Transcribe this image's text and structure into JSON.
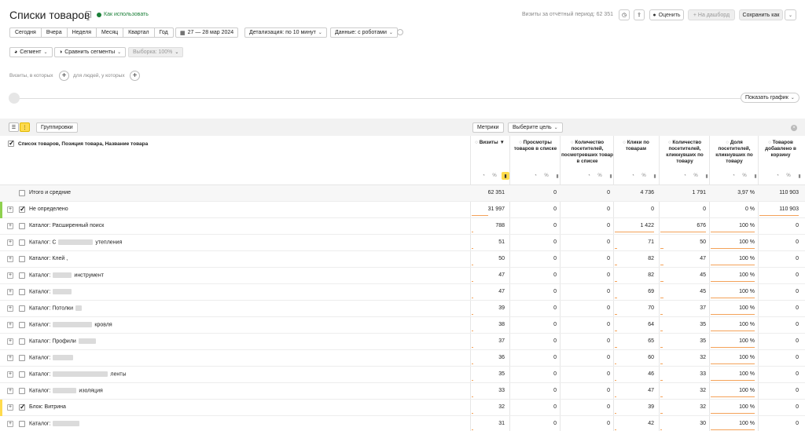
{
  "header": {
    "title": "Списки товаров",
    "howto": "Как использовать",
    "visits_period": "Визиты за отчётный период: 62 351",
    "rate": "Оценить",
    "dashboard": "+ На дашборд",
    "save_as": "Сохранить как"
  },
  "period": {
    "buttons": [
      "Сегодня",
      "Вчера",
      "Неделя",
      "Месяц",
      "Квартал",
      "Год"
    ],
    "date_range": "27 — 28 мар 2024",
    "detail": "Детализация: по 10 минут",
    "data": "Данные: с роботами"
  },
  "segments": {
    "segment": "Сегмент",
    "compare": "Сравнить сегменты",
    "sample": "Выборка: 100%"
  },
  "filters": {
    "visits_hint": "Визиты, в которых",
    "people_hint": "для людей, у которых"
  },
  "graph": {
    "show": "Показать график"
  },
  "table_toolbar": {
    "groupings": "Группировки",
    "metrics": "Метрики",
    "goal": "Выберите цель"
  },
  "dimension_header": "Список товаров, Позиция товара, Название товара",
  "columns": [
    {
      "label": "Визиты",
      "sort": "▼"
    },
    {
      "label": "Просмотры товаров в списке"
    },
    {
      "label": "Количество посетителей, посмотревших товар в списке"
    },
    {
      "label": "Клики по товарам"
    },
    {
      "label": "Количество посетителей, кликнувших по товару"
    },
    {
      "label": "Доля посетителей, кликнувших по товару"
    },
    {
      "label": "Товаров добавлено в корзину"
    }
  ],
  "totals": {
    "label": "Итого и средние",
    "values": [
      "62 351",
      "0",
      "0",
      "4 736",
      "1 791",
      "3,97 %",
      "110 903"
    ]
  },
  "rows": [
    {
      "label": "Не определено",
      "checked": true,
      "marker": "#8fd14f",
      "values": [
        "31 997",
        "0",
        "0",
        "0",
        "0",
        "0 %",
        "110 903"
      ],
      "fill": [
        0.51,
        0,
        0,
        0,
        0,
        0,
        1
      ]
    },
    {
      "label": "Каталог: Расширенный поиск",
      "values": [
        "788",
        "0",
        "0",
        "1 422",
        "676",
        "100 %",
        "0"
      ],
      "fill": [
        0.02,
        0,
        0,
        1,
        1,
        1,
        0
      ]
    },
    {
      "label": "Каталог: С",
      "suffix": "утепления",
      "blur": 44,
      "values": [
        "51",
        "0",
        "0",
        "71",
        "50",
        "100 %",
        "0"
      ],
      "fill": [
        0.01,
        0,
        0,
        0.05,
        0.07,
        1,
        0
      ]
    },
    {
      "label": "Каталог: Клей ,",
      "values": [
        "50",
        "0",
        "0",
        "82",
        "47",
        "100 %",
        "0"
      ],
      "fill": [
        0.01,
        0,
        0,
        0.06,
        0.07,
        1,
        0
      ]
    },
    {
      "label": "Каталог:",
      "suffix": "инструмент",
      "blur": 24,
      "values": [
        "47",
        "0",
        "0",
        "82",
        "45",
        "100 %",
        "0"
      ],
      "fill": [
        0.01,
        0,
        0,
        0.06,
        0.07,
        1,
        0
      ]
    },
    {
      "label": "Каталог:",
      "suffix": "",
      "blur": 24,
      "values": [
        "47",
        "0",
        "0",
        "69",
        "45",
        "100 %",
        "0"
      ],
      "fill": [
        0.01,
        0,
        0,
        0.05,
        0.07,
        1,
        0
      ]
    },
    {
      "label": "Каталог: Потолки",
      "suffix": "",
      "blur": 8,
      "values": [
        "39",
        "0",
        "0",
        "70",
        "37",
        "100 %",
        "0"
      ],
      "fill": [
        0.01,
        0,
        0,
        0.05,
        0.05,
        1,
        0
      ]
    },
    {
      "label": "Каталог:",
      "suffix": "кровля",
      "blur": 50,
      "values": [
        "38",
        "0",
        "0",
        "64",
        "35",
        "100 %",
        "0"
      ],
      "fill": [
        0.01,
        0,
        0,
        0.05,
        0.05,
        1,
        0
      ]
    },
    {
      "label": "Каталог: Профили",
      "suffix": "",
      "blur": 22,
      "values": [
        "37",
        "0",
        "0",
        "65",
        "35",
        "100 %",
        "0"
      ],
      "fill": [
        0.01,
        0,
        0,
        0.05,
        0.05,
        1,
        0
      ]
    },
    {
      "label": "Каталог:",
      "suffix": "",
      "blur": 26,
      "values": [
        "36",
        "0",
        "0",
        "60",
        "32",
        "100 %",
        "0"
      ],
      "fill": [
        0.01,
        0,
        0,
        0.04,
        0.05,
        1,
        0
      ]
    },
    {
      "label": "Каталог:",
      "suffix": "ленты",
      "blur": 70,
      "values": [
        "35",
        "0",
        "0",
        "46",
        "33",
        "100 %",
        "0"
      ],
      "fill": [
        0.01,
        0,
        0,
        0.03,
        0.05,
        1,
        0
      ]
    },
    {
      "label": "Каталог:",
      "suffix": "изоляция",
      "blur": 30,
      "values": [
        "33",
        "0",
        "0",
        "47",
        "32",
        "100 %",
        "0"
      ],
      "fill": [
        0.01,
        0,
        0,
        0.03,
        0.05,
        1,
        0
      ]
    },
    {
      "label": "Блок: Витрина",
      "checked": true,
      "marker": "#ffdb4d",
      "values": [
        "32",
        "0",
        "0",
        "39",
        "32",
        "100 %",
        "0"
      ],
      "fill": [
        0.01,
        0,
        0,
        0.03,
        0.05,
        1,
        0
      ]
    },
    {
      "label": "Каталог:",
      "suffix": "",
      "blur": 34,
      "values": [
        "31",
        "0",
        "0",
        "42",
        "30",
        "100 %",
        "0"
      ],
      "fill": [
        0.01,
        0,
        0,
        0.03,
        0.04,
        1,
        0
      ]
    }
  ],
  "colors": {
    "accent": "#ffdb4d",
    "bar": "#f4a259",
    "green": "#1a7f37"
  }
}
